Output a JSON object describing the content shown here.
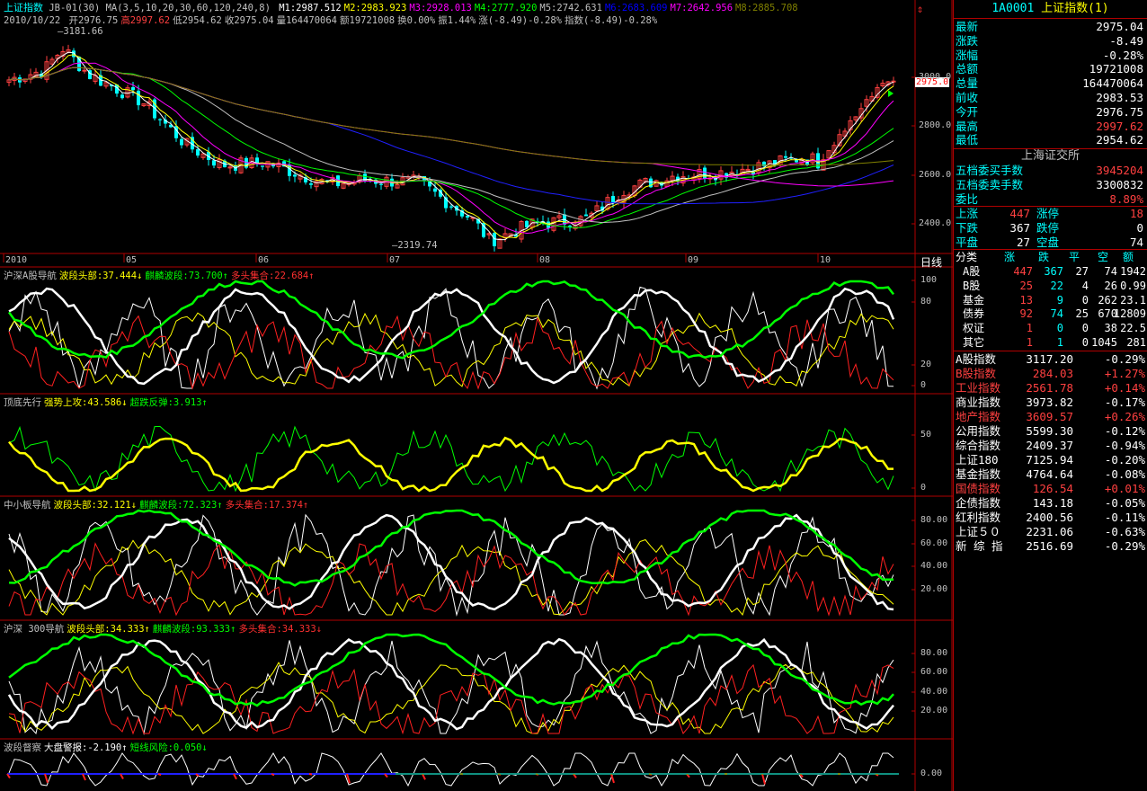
{
  "header": {
    "title": "上证指数",
    "formula": "JB-01(30)",
    "ma_label": "MA(3,5,10,20,30,60,120,240,8)",
    "ma_values": [
      {
        "t": "M1:2987.512",
        "c": "#ffffff"
      },
      {
        "t": "M2:2983.923",
        "c": "#ffff00"
      },
      {
        "t": "M3:2928.013",
        "c": "#ff00ff"
      },
      {
        "t": "M4:2777.920",
        "c": "#00ff00"
      },
      {
        "t": "M5:2742.631",
        "c": "#c0c0c0"
      },
      {
        "t": "M6:2683.609",
        "c": "#0000ff"
      },
      {
        "t": "M7:2642.956",
        "c": "#ff00ff"
      },
      {
        "t": "M8:2885.708",
        "c": "#808000"
      }
    ],
    "date": "2010/10/22",
    "quote": [
      {
        "t": "开2976.75",
        "c": "#c0c0c0"
      },
      {
        "t": "高2997.62",
        "c": "#ff4040"
      },
      {
        "t": "低2954.62",
        "c": "#c0c0c0"
      },
      {
        "t": "收2975.04",
        "c": "#c0c0c0"
      },
      {
        "t": "量164470064",
        "c": "#c0c0c0"
      },
      {
        "t": "额19721008",
        "c": "#c0c0c0"
      },
      {
        "t": "换0.00%",
        "c": "#c0c0c0"
      },
      {
        "t": "振1.44%",
        "c": "#c0c0c0"
      },
      {
        "t": "涨(-8.49)-0.28%",
        "c": "#c0c0c0"
      },
      {
        "t": "指数(-8.49)-0.28%",
        "c": "#c0c0c0"
      }
    ],
    "high_mark": "3181.66",
    "low_mark": "2319.74",
    "current_price_tag": "2975.0"
  },
  "price_axis": [
    "3000.0",
    "2800.0",
    "2600.0",
    "2400.0"
  ],
  "months": [
    "2010",
    "05",
    "06",
    "07",
    "08",
    "09",
    "10"
  ],
  "period": "日线",
  "indicators": [
    {
      "name": "沪深A股导航",
      "parts": [
        {
          "t": "波段头部:37.444↓",
          "c": "#ffff00"
        },
        {
          "t": "麒麟波段:73.700↑",
          "c": "#00ff00"
        },
        {
          "t": "多头集合:22.684↑",
          "c": "#ff3030"
        }
      ],
      "axis": [
        "100",
        "80",
        "20",
        "0"
      ]
    },
    {
      "name": "顶底先行",
      "parts": [
        {
          "t": "强势上攻:43.586↓",
          "c": "#ffff00"
        },
        {
          "t": "超跌反弹:3.913↑",
          "c": "#00ff00"
        }
      ],
      "axis": [
        "50",
        "0"
      ]
    },
    {
      "name": "中小板导航",
      "parts": [
        {
          "t": "波段头部:32.121↓",
          "c": "#ffff00"
        },
        {
          "t": "麒麟波段:72.323↑",
          "c": "#00ff00"
        },
        {
          "t": "多头集合:17.374↑",
          "c": "#ff3030"
        }
      ],
      "axis": [
        "80.00",
        "60.00",
        "40.00",
        "20.00"
      ]
    },
    {
      "name": "沪深 300导航",
      "parts": [
        {
          "t": "波段头部:34.333↑",
          "c": "#ffff00"
        },
        {
          "t": "麒麟波段:93.333↑",
          "c": "#00ff00"
        },
        {
          "t": "多头集合:34.333↓",
          "c": "#ff3030"
        }
      ],
      "axis": [
        "80.00",
        "60.00",
        "40.00",
        "20.00"
      ]
    },
    {
      "name": "波段督察",
      "parts": [
        {
          "t": "大盘警报:-2.190↑",
          "c": "#ffffff"
        },
        {
          "t": "短线风险:0.050↓",
          "c": "#00ff00"
        }
      ],
      "axis": [
        "0.00"
      ]
    }
  ],
  "panel": {
    "code": "1A0001",
    "name": "上证指数",
    "suffix": "(1)",
    "quote_rows": [
      {
        "label": "最新",
        "value": "2975.04",
        "lc": "#00ffff",
        "vc": "#ffffff"
      },
      {
        "label": "涨跌",
        "value": "-8.49",
        "lc": "#00ffff",
        "vc": "#ffffff"
      },
      {
        "label": "涨幅",
        "value": "-0.28%",
        "lc": "#00ffff",
        "vc": "#ffffff"
      },
      {
        "label": "总额",
        "value": "19721008",
        "lc": "#00ffff",
        "vc": "#ffffff"
      },
      {
        "label": "总量",
        "value": "164470064",
        "lc": "#00ffff",
        "vc": "#ffffff"
      },
      {
        "label": "前收",
        "value": "2983.53",
        "lc": "#00ffff",
        "vc": "#ffffff"
      },
      {
        "label": "今开",
        "value": "2976.75",
        "lc": "#00ffff",
        "vc": "#ffffff"
      },
      {
        "label": "最高",
        "value": "2997.62",
        "lc": "#00ffff",
        "vc": "#ff4040"
      },
      {
        "label": "最低",
        "value": "2954.62",
        "lc": "#00ffff",
        "vc": "#ffffff"
      }
    ],
    "exchange": "上海证交所",
    "order_rows": [
      {
        "label": "五档委买手数",
        "value": "3945204",
        "vc": "#ff4040"
      },
      {
        "label": "五档委卖手数",
        "value": "3300832",
        "vc": "#ffffff"
      },
      {
        "label": "委比",
        "value": "8.89%",
        "vc": "#ff4040"
      }
    ],
    "breadth_rows": [
      {
        "l1": "上涨",
        "v1": "447",
        "l2": "涨停",
        "v2": "18",
        "c": "#ff4040"
      },
      {
        "l1": "下跌",
        "v1": "367",
        "l2": "跌停",
        "v2": "0",
        "c": "#ffffff"
      },
      {
        "l1": "平盘",
        "v1": "27",
        "l2": "空盘",
        "v2": "74",
        "c": "#ffffff"
      }
    ],
    "class_header": [
      "分类",
      "涨",
      "跌",
      "平",
      "空",
      "额"
    ],
    "class_rows": [
      {
        "name": "A股",
        "up": "447",
        "down": "367",
        "flat": "27",
        "empty": "74",
        "amt": "1942"
      },
      {
        "name": "B股",
        "up": "25",
        "down": "22",
        "flat": "4",
        "empty": "26",
        "amt": "0.99"
      },
      {
        "name": "基金",
        "up": "13",
        "down": "9",
        "flat": "0",
        "empty": "262",
        "amt": "23.1"
      },
      {
        "name": "债券",
        "up": "92",
        "down": "74",
        "flat": "25",
        "empty": "670",
        "amt": "12809"
      },
      {
        "name": "权证",
        "up": "1",
        "down": "0",
        "flat": "0",
        "empty": "38",
        "amt": "22.5"
      },
      {
        "name": "其它",
        "up": "1",
        "down": "1",
        "flat": "0",
        "empty": "1045",
        "amt": "281"
      }
    ],
    "indices": [
      {
        "name": "A股指数",
        "price": "3117.20",
        "chg": "-0.29%",
        "nc": "#ffffff",
        "pc": "#ffffff",
        "cc": "#ffffff"
      },
      {
        "name": "B股指数",
        "price": "284.03",
        "chg": "+1.27%",
        "nc": "#ff4040",
        "pc": "#ff4040",
        "cc": "#ff4040"
      },
      {
        "name": "工业指数",
        "price": "2561.78",
        "chg": "+0.14%",
        "nc": "#ff4040",
        "pc": "#ff4040",
        "cc": "#ff4040"
      },
      {
        "name": "商业指数",
        "price": "3973.82",
        "chg": "-0.17%",
        "nc": "#ffffff",
        "pc": "#ffffff",
        "cc": "#ffffff"
      },
      {
        "name": "地产指数",
        "price": "3609.57",
        "chg": "+0.26%",
        "nc": "#ff4040",
        "pc": "#ff4040",
        "cc": "#ff4040"
      },
      {
        "name": "公用指数",
        "price": "5599.30",
        "chg": "-0.12%",
        "nc": "#ffffff",
        "pc": "#ffffff",
        "cc": "#ffffff"
      },
      {
        "name": "综合指数",
        "price": "2409.37",
        "chg": "-0.94%",
        "nc": "#ffffff",
        "pc": "#ffffff",
        "cc": "#ffffff"
      },
      {
        "name": "上证180",
        "price": "7125.94",
        "chg": "-0.20%",
        "nc": "#ffffff",
        "pc": "#ffffff",
        "cc": "#ffffff"
      },
      {
        "name": "基金指数",
        "price": "4764.64",
        "chg": "-0.08%",
        "nc": "#ffffff",
        "pc": "#ffffff",
        "cc": "#ffffff"
      },
      {
        "name": "国债指数",
        "price": "126.54",
        "chg": "+0.01%",
        "nc": "#ff4040",
        "pc": "#ff4040",
        "cc": "#ff4040"
      },
      {
        "name": "企债指数",
        "price": "143.18",
        "chg": "-0.05%",
        "nc": "#ffffff",
        "pc": "#ffffff",
        "cc": "#ffffff"
      },
      {
        "name": "红利指数",
        "price": "2400.56",
        "chg": "-0.11%",
        "nc": "#ffffff",
        "pc": "#ffffff",
        "cc": "#ffffff"
      },
      {
        "name": "上证５０",
        "price": "2231.06",
        "chg": "-0.63%",
        "nc": "#ffffff",
        "pc": "#ffffff",
        "cc": "#ffffff"
      },
      {
        "name": "新 综 指",
        "price": "2516.69",
        "chg": "-0.29%",
        "nc": "#ffffff",
        "pc": "#ffffff",
        "cc": "#ffffff"
      }
    ]
  },
  "colors": {
    "up": "#ff4040",
    "down": "#00ffff",
    "frame": "#b00000",
    "label": "#00ffff"
  }
}
